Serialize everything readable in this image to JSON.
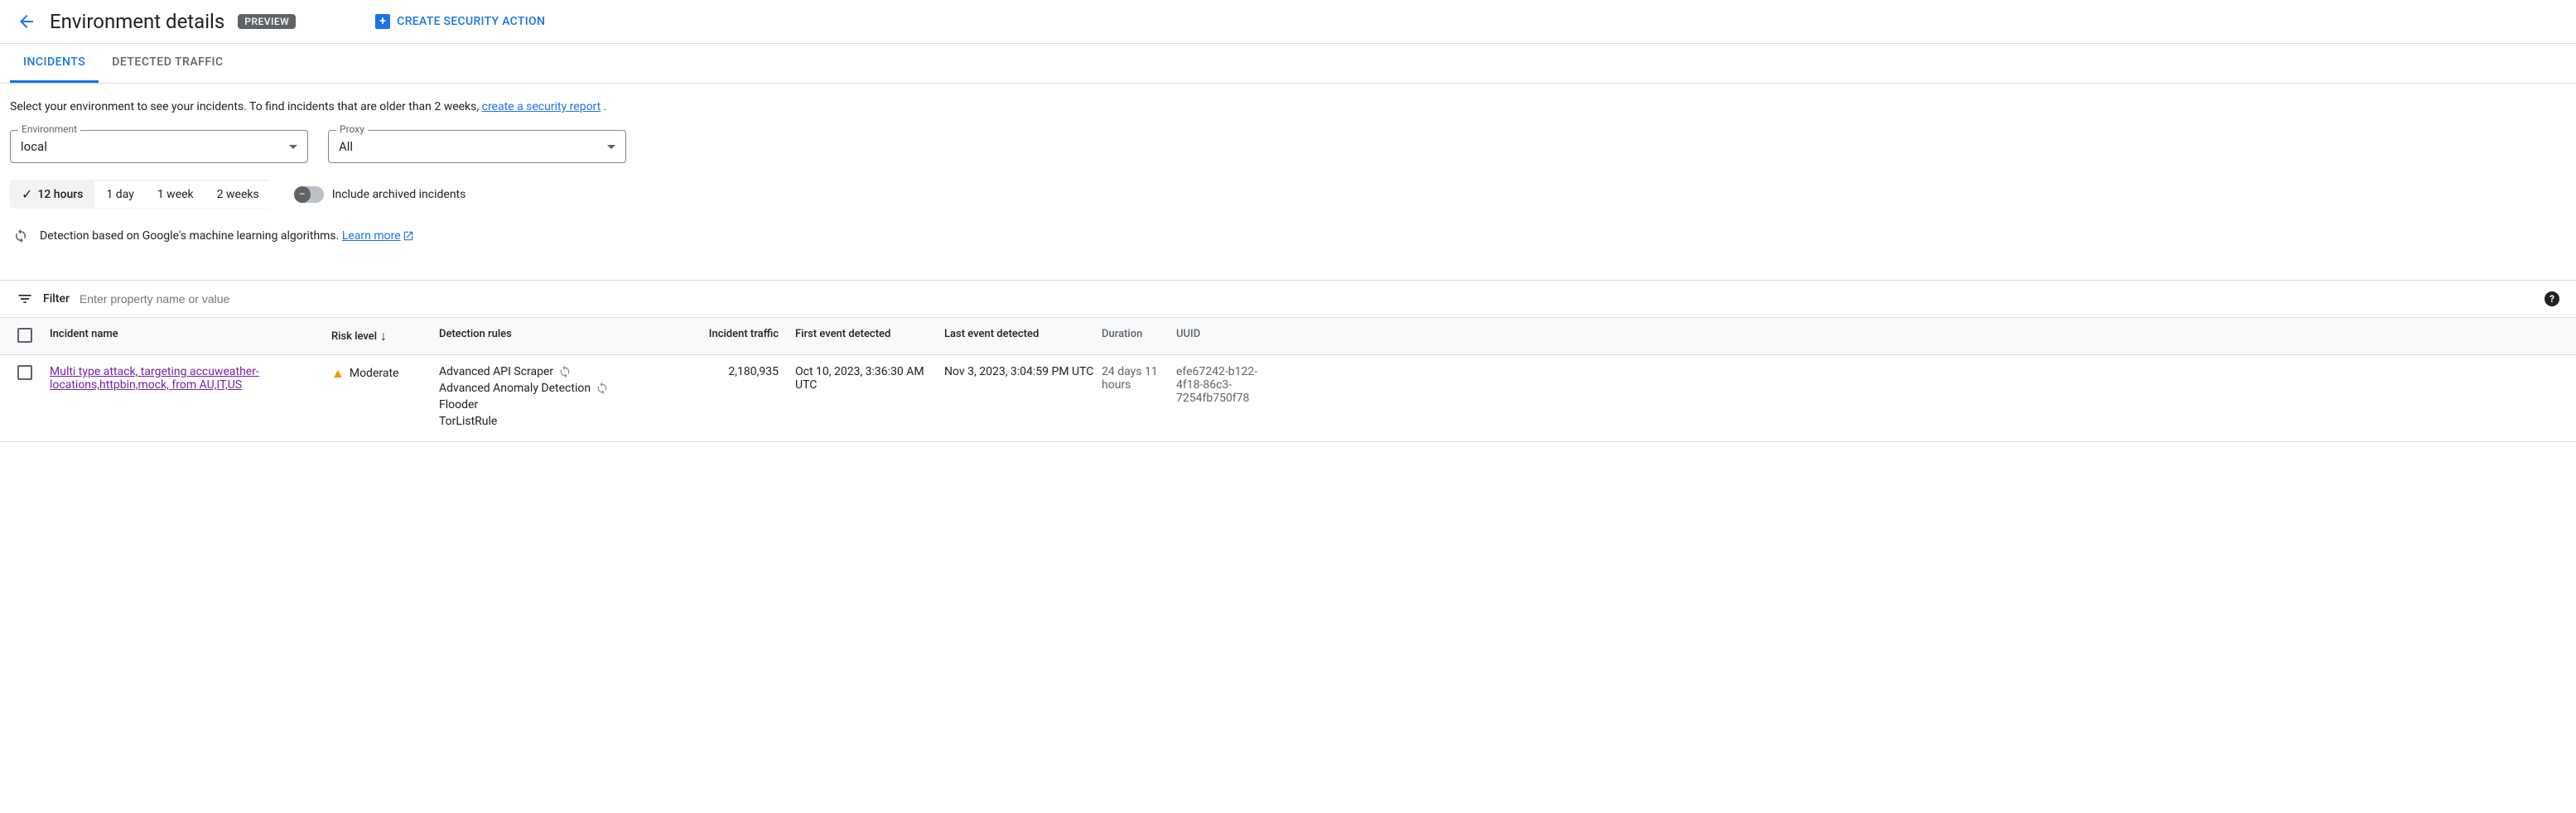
{
  "header": {
    "title": "Environment details",
    "badge": "PREVIEW",
    "create_action": "CREATE SECURITY ACTION"
  },
  "tabs": {
    "incidents": "INCIDENTS",
    "detected": "DETECTED TRAFFIC"
  },
  "intro": {
    "text_before": "Select your environment to see your incidents. To find incidents that are older than 2 weeks, ",
    "link": "create a security report",
    "text_after": " ."
  },
  "selectors": {
    "env_label": "Environment",
    "env_value": "local",
    "proxy_label": "Proxy",
    "proxy_value": "All"
  },
  "time_range": {
    "opt1": "12 hours",
    "opt2": "1 day",
    "opt3": "1 week",
    "opt4": "2 weeks"
  },
  "toggle": {
    "label": "Include archived incidents"
  },
  "ml_info": {
    "text": "Detection based on Google's machine learning algorithms. ",
    "link": "Learn more"
  },
  "filter": {
    "label": "Filter",
    "placeholder": "Enter property name or value"
  },
  "columns": {
    "name": "Incident name",
    "risk": "Risk level",
    "rules": "Detection rules",
    "traffic": "Incident traffic",
    "first": "First event detected",
    "last": "Last event detected",
    "duration": "Duration",
    "uuid": "UUID"
  },
  "row": {
    "name": "Multi type attack, targeting accuweather-locations,httpbin,mock, from AU,IT,US",
    "risk": "Moderate",
    "rule1": "Advanced API Scraper",
    "rule2": "Advanced Anomaly Detection",
    "rule3": "Flooder",
    "rule4": "TorListRule",
    "traffic": "2,180,935",
    "first": "Oct 10, 2023, 3:36:30 AM UTC",
    "last": "Nov 3, 2023, 3:04:59 PM UTC",
    "duration": "24 days 11 hours",
    "uuid": "efe67242-b122-4f18-86c3-7254fb750f78"
  }
}
